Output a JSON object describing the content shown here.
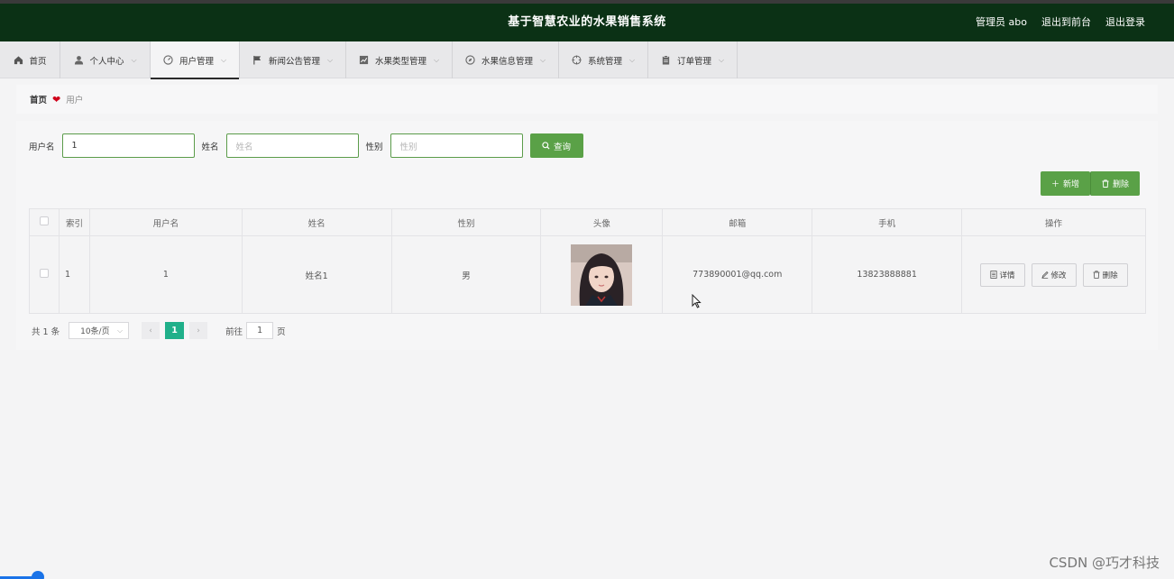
{
  "header": {
    "title": "基于智慧农业的水果销售系统",
    "admin": "管理员 abo",
    "to_front": "退出到前台",
    "logout": "退出登录"
  },
  "nav": {
    "items": [
      {
        "label": "首页",
        "icon": "home-icon"
      },
      {
        "label": "个人中心",
        "icon": "user-icon"
      },
      {
        "label": "用户管理",
        "icon": "dashboard-icon"
      },
      {
        "label": "新闻公告管理",
        "icon": "flag-icon"
      },
      {
        "label": "水果类型管理",
        "icon": "chart-icon"
      },
      {
        "label": "水果信息管理",
        "icon": "compass-icon"
      },
      {
        "label": "系统管理",
        "icon": "target-icon"
      },
      {
        "label": "订单管理",
        "icon": "clipboard-icon"
      }
    ]
  },
  "breadcrumb": {
    "home": "首页",
    "current": "用户"
  },
  "search": {
    "username_label": "用户名",
    "username_value": "1",
    "name_label": "姓名",
    "name_placeholder": "姓名",
    "gender_label": "性别",
    "gender_placeholder": "性别",
    "query_label": "查询"
  },
  "actions": {
    "add_label": "新增",
    "delete_label": "删除"
  },
  "table": {
    "headers": [
      "索引",
      "用户名",
      "姓名",
      "性别",
      "头像",
      "邮箱",
      "手机",
      "操作"
    ],
    "rows": [
      {
        "index": "1",
        "username": "1",
        "name": "姓名1",
        "gender": "男",
        "email": "773890001@qq.com",
        "phone": "13823888881"
      }
    ],
    "op_detail": "详情",
    "op_edit": "修改",
    "op_delete": "删除"
  },
  "pager": {
    "total": "共 1 条",
    "page_size": "10条/页",
    "current_page": "1",
    "goto_label": "前往",
    "goto_value": "1",
    "page_unit": "页"
  },
  "watermark": "CSDN @巧才科技"
}
